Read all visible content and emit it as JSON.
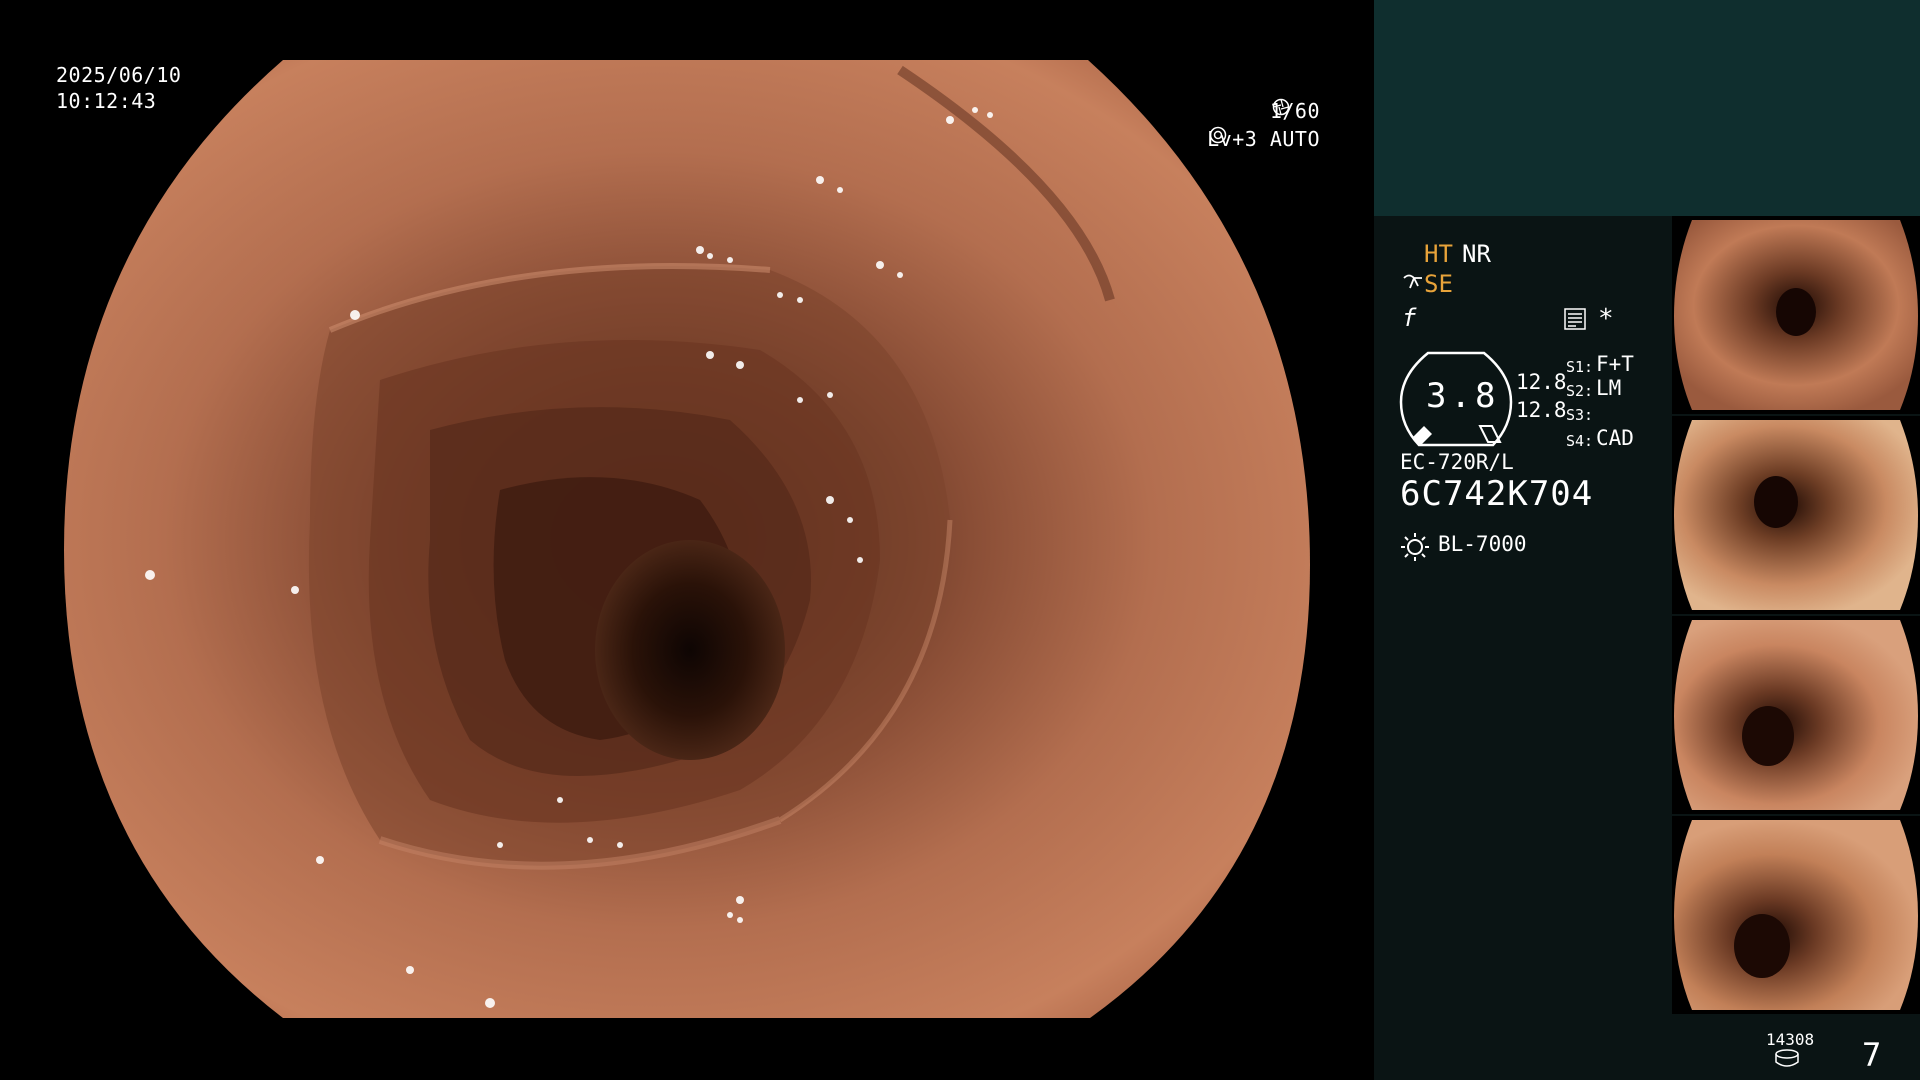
{
  "osd": {
    "date": "2025/06/10",
    "time": "10:12:43",
    "shutter": "1/60",
    "level": "Lv+3 AUTO",
    "shutter_icon": "aperture-icon",
    "level_icon": "auto-iris-icon"
  },
  "settings": {
    "ht": "HT",
    "nr": "NR",
    "se": "SE",
    "f_symbol": "f",
    "asterisk": "*",
    "dial_value": "3.8",
    "gain_1": "12.8",
    "gain_2": "12.8",
    "s1_key": "S1:",
    "s1_val": "F+T",
    "s2_key": "S2:",
    "s2_val": "LM",
    "s3_key": "S3:",
    "s3_val": "",
    "s4_key": "S4:",
    "s4_val": "CAD"
  },
  "device": {
    "scope_model": "EC-720R/L",
    "serial": "6C742K704",
    "light_source": "BL-7000"
  },
  "capture": {
    "count": "14308",
    "page": "7"
  },
  "colors": {
    "panel_top": "#0f2e2e",
    "panel": "#0a1414",
    "amber": "#e8a33a"
  }
}
